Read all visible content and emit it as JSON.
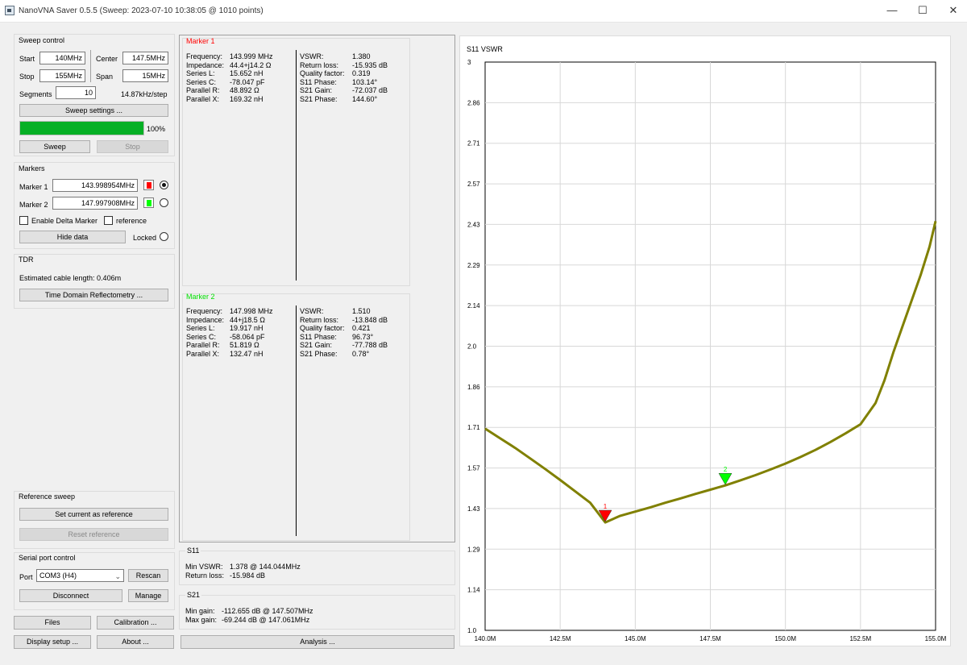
{
  "window": {
    "title": "NanoVNA Saver 0.5.5 (Sweep: 2023-07-10 10:38:05 @ 1010 points)",
    "minimize": "—",
    "maximize": "☐",
    "close": "✕"
  },
  "sweep_control": {
    "title": "Sweep control",
    "start_label": "Start",
    "start_value": "140MHz",
    "center_label": "Center",
    "center_value": "147.5MHz",
    "stop_label": "Stop",
    "stop_value": "155MHz",
    "span_label": "Span",
    "span_value": "15MHz",
    "segments_label": "Segments",
    "segments_value": "10",
    "step_text": "14.87kHz/step",
    "settings_button": "Sweep settings ...",
    "progress_percent": 100,
    "progress_text": "100%",
    "sweep_button": "Sweep",
    "stop_button": "Stop"
  },
  "markers": {
    "title": "Markers",
    "marker1_label": "Marker 1",
    "marker1_value": "143.998954MHz",
    "marker1_color": "#ff0000",
    "marker2_label": "Marker 2",
    "marker2_value": "147.997908MHz",
    "marker2_color": "#00ff00",
    "delta_label": "Enable Delta Marker",
    "reference_label": "reference",
    "hide_button": "Hide data",
    "locked_label": "Locked"
  },
  "tdr": {
    "title": "TDR",
    "cable_text": "Estimated cable length:  0.406m",
    "button": "Time Domain Reflectometry ..."
  },
  "reference_sweep": {
    "title": "Reference sweep",
    "set_button": "Set current as reference",
    "reset_button": "Reset reference"
  },
  "serial": {
    "title": "Serial port control",
    "port_label": "Port",
    "port_value": "COM3 (H4)",
    "rescan_button": "Rescan",
    "disconnect_button": "Disconnect",
    "manage_button": "Manage"
  },
  "bottom_buttons": {
    "files": "Files",
    "calibration": "Calibration ...",
    "display_setup": "Display setup ...",
    "about": "About ...",
    "analysis": "Analysis ..."
  },
  "marker1_info": {
    "title": "Marker 1",
    "left": [
      [
        "Frequency:",
        "143.999 MHz"
      ],
      [
        "Impedance:",
        "44.4+j14.2 Ω"
      ],
      [
        "Series L:",
        "15.652 nH"
      ],
      [
        "Series C:",
        "-78.047 pF"
      ],
      [
        "Parallel R:",
        "48.892 Ω"
      ],
      [
        "Parallel X:",
        "169.32 nH"
      ]
    ],
    "right": [
      [
        "VSWR:",
        "1.380"
      ],
      [
        "Return loss:",
        "-15.935 dB"
      ],
      [
        "Quality factor:",
        "0.319"
      ],
      [
        "S11 Phase:",
        "103.14°"
      ],
      [
        "S21 Gain:",
        "-72.037 dB"
      ],
      [
        "S21 Phase:",
        "144.60°"
      ]
    ]
  },
  "marker2_info": {
    "title": "Marker 2",
    "left": [
      [
        "Frequency:",
        "147.998 MHz"
      ],
      [
        "Impedance:",
        "44+j18.5 Ω"
      ],
      [
        "Series L:",
        "19.917 nH"
      ],
      [
        "Series C:",
        "-58.064 pF"
      ],
      [
        "Parallel R:",
        "51.819 Ω"
      ],
      [
        "Parallel X:",
        "132.47 nH"
      ]
    ],
    "right": [
      [
        "VSWR:",
        "1.510"
      ],
      [
        "Return loss:",
        "-13.848 dB"
      ],
      [
        "Quality factor:",
        "0.421"
      ],
      [
        "S11 Phase:",
        "96.73°"
      ],
      [
        "S21 Gain:",
        "-77.788 dB"
      ],
      [
        "S21 Phase:",
        "0.78°"
      ]
    ]
  },
  "s11_summary": {
    "title": "S11",
    "rows": [
      [
        "Min VSWR:",
        "1.378 @ 144.044MHz"
      ],
      [
        "Return loss:",
        "-15.984 dB"
      ]
    ]
  },
  "s21_summary": {
    "title": "S21",
    "rows": [
      [
        "Min gain:",
        "-112.655 dB @ 147.507MHz"
      ],
      [
        "Max gain:",
        "-69.244 dB @ 147.061MHz"
      ]
    ]
  },
  "chart_data": {
    "type": "line",
    "title": "S11 VSWR",
    "x_ticks": [
      "140.0M",
      "142.5M",
      "145.0M",
      "147.5M",
      "150.0M",
      "152.5M",
      "155.0M"
    ],
    "y_ticks": [
      "3",
      "2.86",
      "2.71",
      "2.57",
      "2.43",
      "2.29",
      "2.14",
      "2.0",
      "1.86",
      "1.71",
      "1.57",
      "1.43",
      "1.29",
      "1.14",
      "1.0"
    ],
    "xlim": [
      140.0,
      155.0
    ],
    "ylim": [
      1.0,
      3.0
    ],
    "grid": true,
    "line_color": "#808000",
    "series": [
      {
        "x": [
          140.0,
          140.5,
          141.0,
          141.5,
          142.0,
          142.5,
          143.0,
          143.5,
          144.0,
          144.5,
          145.0,
          145.5,
          146.0,
          146.5,
          147.0,
          147.5,
          148.0,
          148.5,
          149.0,
          149.5,
          150.0,
          150.5,
          151.0,
          151.5,
          152.0,
          152.5,
          153.0,
          153.3,
          153.6,
          153.9,
          154.2,
          154.5,
          154.8,
          155.0
        ],
        "y": [
          1.71,
          1.676,
          1.642,
          1.605,
          1.568,
          1.529,
          1.489,
          1.449,
          1.38,
          1.403,
          1.418,
          1.433,
          1.449,
          1.464,
          1.48,
          1.495,
          1.51,
          1.528,
          1.546,
          1.566,
          1.587,
          1.61,
          1.635,
          1.663,
          1.693,
          1.725,
          1.8,
          1.88,
          1.98,
          2.07,
          2.16,
          2.25,
          2.35,
          2.44
        ]
      }
    ],
    "markers": [
      {
        "label": "1",
        "x": 143.999,
        "y": 1.38,
        "color": "#ff0000"
      },
      {
        "label": "2",
        "x": 147.998,
        "y": 1.51,
        "color": "#00ff00"
      }
    ]
  }
}
